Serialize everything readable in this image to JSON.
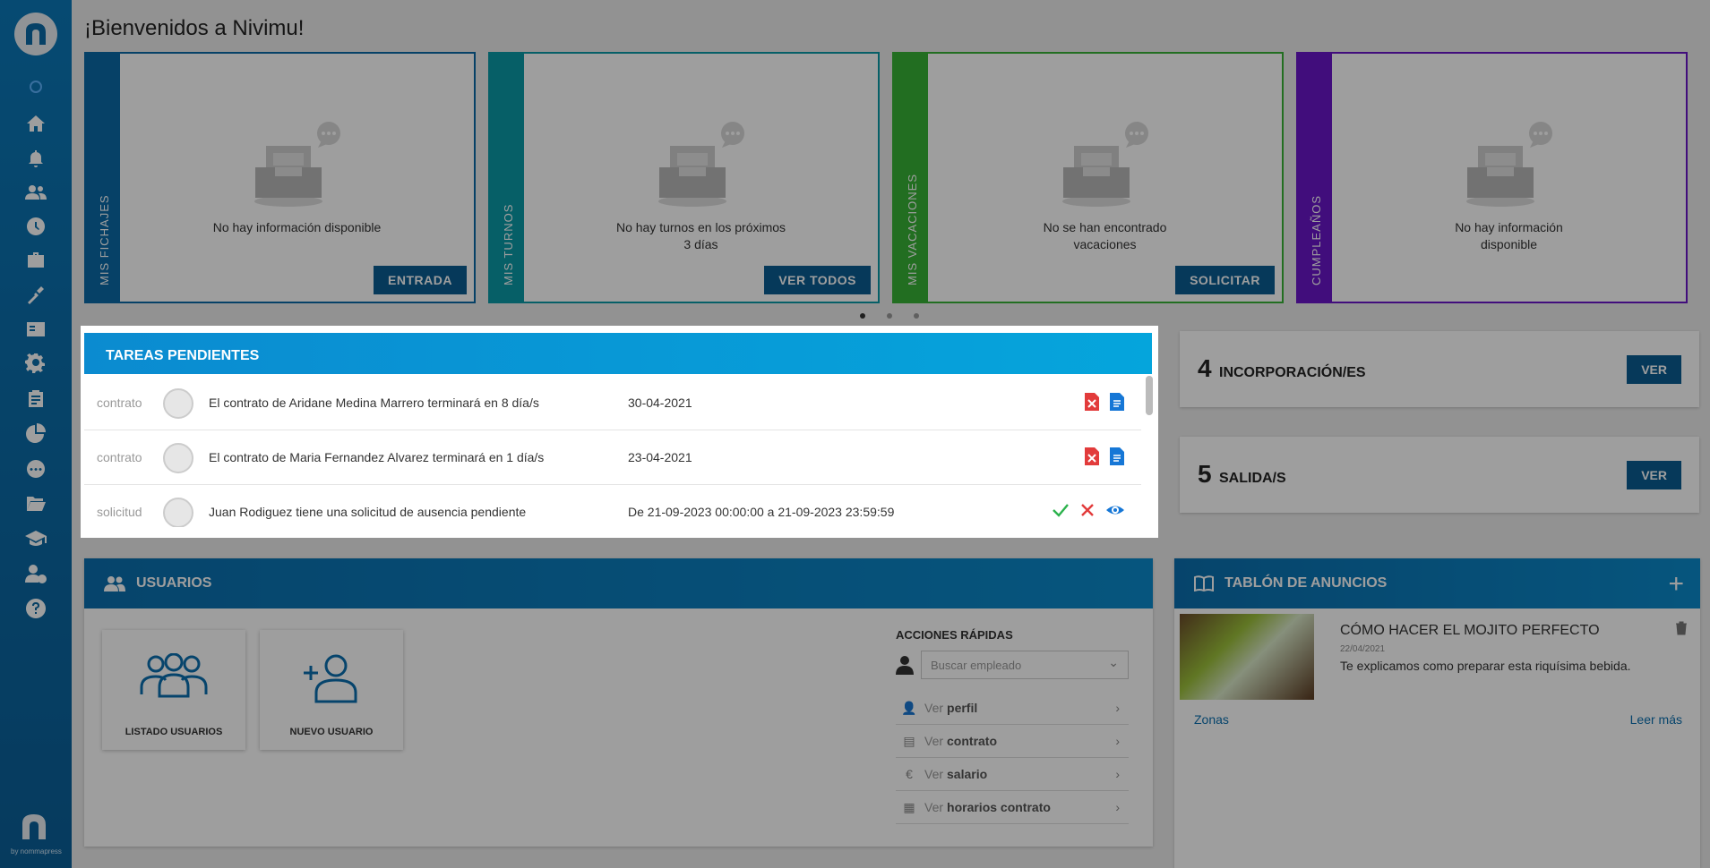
{
  "page": {
    "title": "¡Bienvenidos a Nivimu!"
  },
  "sidebar": {
    "icons": [
      "home-icon",
      "bell-icon",
      "users-icon",
      "clock-icon",
      "briefcase-icon",
      "spray-icon",
      "id-card-icon",
      "gear-icon",
      "clipboard-icon",
      "pie-chart-icon",
      "chat-icon",
      "folder-icon",
      "graduation-icon",
      "user-money-icon",
      "help-icon"
    ],
    "footer": "by nommapress"
  },
  "cards": [
    {
      "label": "MIS FICHAJES",
      "text": [
        "No hay información disponible"
      ],
      "button": "ENTRADA",
      "color": "#0a6aa6"
    },
    {
      "label": "MIS TURNOS",
      "text": [
        "No hay turnos en los próximos",
        "3 días"
      ],
      "button": "VER TODOS",
      "color": "#0b9aa6"
    },
    {
      "label": "MIS VACACIONES",
      "text": [
        "No se han encontrado",
        "vacaciones"
      ],
      "button": "SOLICITAR",
      "color": "#37b236"
    },
    {
      "label": "CUMPLEAÑOS",
      "text": [
        "No hay información",
        "disponible"
      ],
      "button": "",
      "color": "#6a16c8"
    }
  ],
  "tasks": {
    "title": "TAREAS PENDIENTES",
    "rows": [
      {
        "type": "contrato",
        "text": "El contrato de Aridane Medina Marrero terminará en 8 día/s",
        "date": "30-04-2021",
        "actions": [
          "file-delete-icon",
          "file-text-icon"
        ]
      },
      {
        "type": "contrato",
        "text": "El contrato de Maria Fernandez Alvarez terminará en 1 día/s",
        "date": "23-04-2021",
        "actions": [
          "file-delete-icon",
          "file-text-icon"
        ]
      },
      {
        "type": "solicitud",
        "text": "Juan Rodiguez tiene una solicitud de ausencia pendiente",
        "date": "De 21-09-2023 00:00:00 a 21-09-2023 23:59:59",
        "actions": [
          "check-icon",
          "close-icon",
          "eye-icon"
        ]
      }
    ]
  },
  "stats": [
    {
      "number": "4",
      "label": "INCORPORACIÓN/ES",
      "button": "VER"
    },
    {
      "number": "5",
      "label": "SALIDA/S",
      "button": "VER"
    }
  ],
  "users": {
    "title": "USUARIOS",
    "tiles": [
      "LISTADO USUARIOS",
      "NUEVO USUARIO"
    ],
    "quick": {
      "title": "ACCIONES RÁPIDAS",
      "placeholder": "Buscar empleado",
      "items": [
        {
          "prefix": "Ver",
          "bold": "perfil",
          "icon": "user-icon"
        },
        {
          "prefix": "Ver",
          "bold": "contrato",
          "icon": "document-icon"
        },
        {
          "prefix": "Ver",
          "bold": "salario",
          "icon": "euro-icon"
        },
        {
          "prefix": "Ver",
          "bold": "horarios contrato",
          "icon": "calendar-icon"
        }
      ]
    }
  },
  "news": {
    "title": "TABLÓN DE ANUNCIOS",
    "item": {
      "title": "CÓMO HACER EL MOJITO PERFECTO",
      "date": "22/04/2021",
      "text": "Te explicamos como preparar esta riquísima bebida.",
      "zone": "Zonas",
      "more": "Leer más"
    }
  }
}
